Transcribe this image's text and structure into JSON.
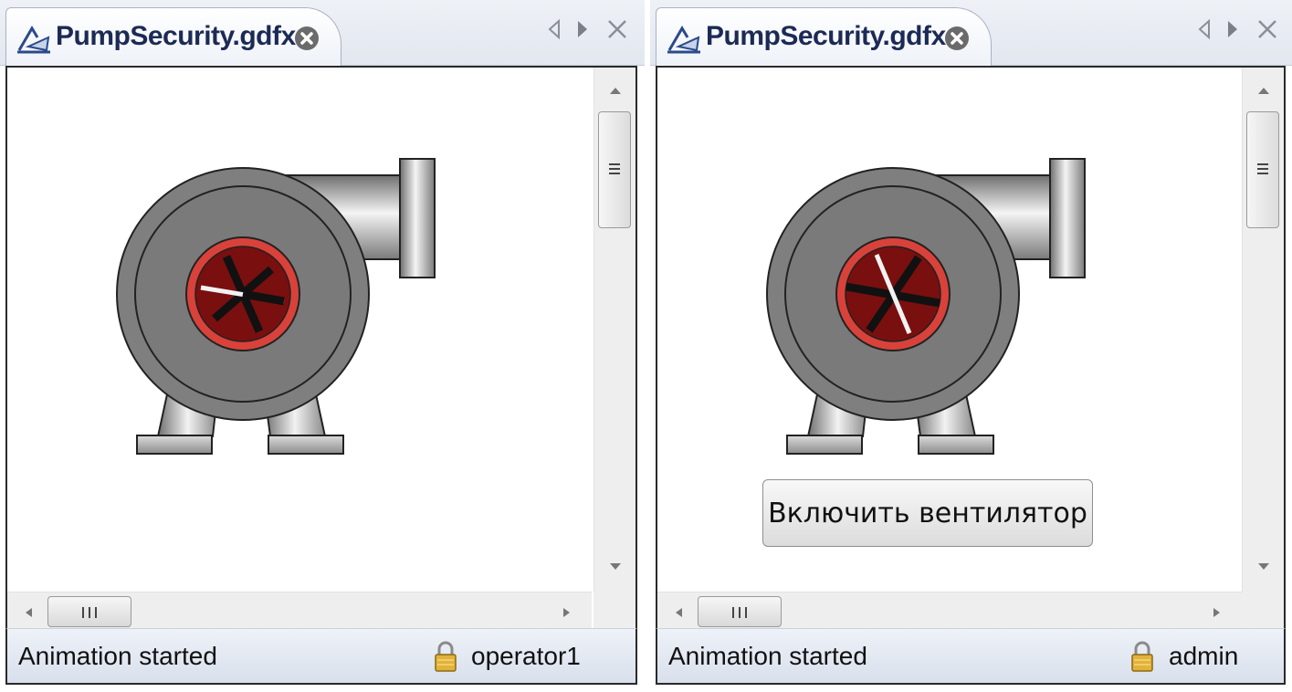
{
  "left_editor": {
    "tab": {
      "icon": "diagram-file-icon",
      "label": "PumpSecurity.gdfx",
      "close_icon": "close-circle-icon"
    },
    "tab_controls": [
      "prev-tab-icon",
      "next-tab-icon",
      "close-icon"
    ],
    "canvas": {
      "pump_graphic": "pump-icon",
      "fan_state": "stopped"
    },
    "scrollbars": {
      "vertical": "vertical-scrollbar",
      "horizontal": "horizontal-scrollbar"
    },
    "status": {
      "message": "Animation started",
      "lock_icon": "lock-icon",
      "user": "operator1"
    }
  },
  "right_editor": {
    "tab": {
      "icon": "diagram-file-icon",
      "label": "PumpSecurity.gdfx",
      "close_icon": "close-circle-icon"
    },
    "tab_controls": [
      "prev-tab-icon",
      "next-tab-icon",
      "close-icon"
    ],
    "canvas": {
      "pump_graphic": "pump-icon",
      "fan_state": "rotated",
      "button_label": "Включить вентилятор"
    },
    "scrollbars": {
      "vertical": "vertical-scrollbar",
      "horizontal": "horizontal-scrollbar"
    },
    "status": {
      "message": "Animation started",
      "lock_icon": "lock-icon",
      "user": "admin"
    }
  },
  "colors": {
    "pump_body": "#808080",
    "impeller_ring": "#d9423a",
    "impeller_fill": "#7a0f0f",
    "tab_text": "#1c2a55",
    "status_bg": "#dfe5ef"
  }
}
